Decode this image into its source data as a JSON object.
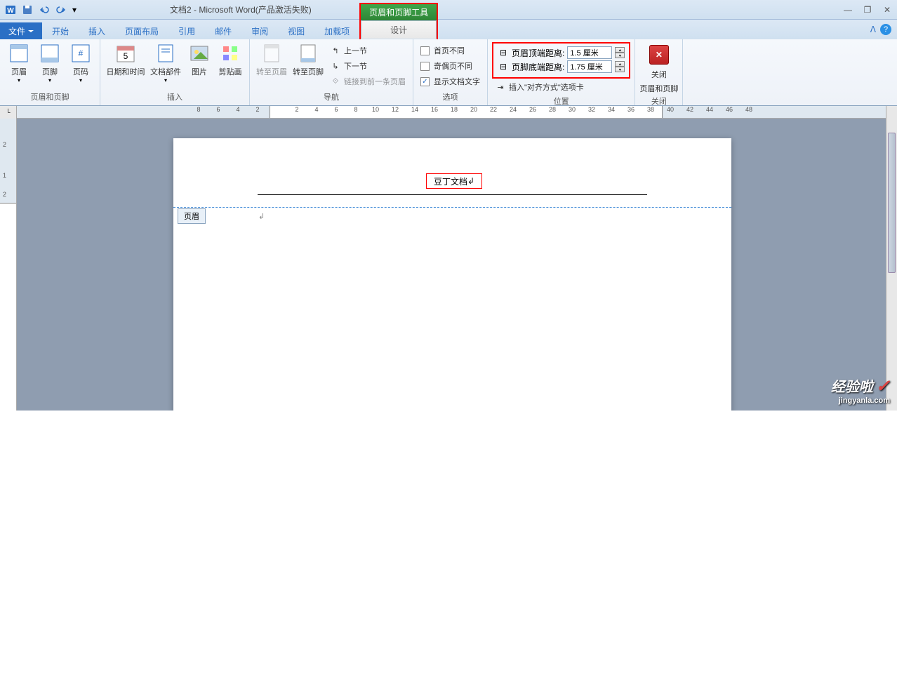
{
  "title": "文档2 - Microsoft Word(产品激活失败)",
  "contextual": {
    "group": "页眉和页脚工具",
    "tab": "设计"
  },
  "tabs": {
    "file": "文件",
    "items": [
      "开始",
      "插入",
      "页面布局",
      "引用",
      "邮件",
      "审阅",
      "视图",
      "加载项"
    ]
  },
  "ribbon": {
    "group1": {
      "label": "页眉和页脚",
      "header": "页眉",
      "footer": "页脚",
      "pagenum": "页码"
    },
    "group2": {
      "label": "插入",
      "datetime": "日期和时间",
      "docparts": "文档部件",
      "picture": "图片",
      "clipart": "剪贴画"
    },
    "group3": {
      "label": "导航",
      "goto_header": "转至页眉",
      "goto_footer": "转至页脚",
      "prev": "上一节",
      "next": "下一节",
      "link_prev": "链接到前一条页眉"
    },
    "group4": {
      "label": "选项",
      "first_diff": "首页不同",
      "odd_even": "奇偶页不同",
      "show_doc": "显示文档文字"
    },
    "group5": {
      "label": "位置",
      "header_top_label": "页眉顶端距离:",
      "header_top_val": "1.5 厘米",
      "footer_bottom_label": "页脚底端距离:",
      "footer_bottom_val": "1.75 厘米",
      "insert_align": "插入\"对齐方式\"选项卡"
    },
    "group6": {
      "label": "关闭",
      "close": "关闭",
      "close_sub": "页眉和页脚"
    }
  },
  "ruler_h": [
    "8",
    "6",
    "4",
    "2",
    "",
    "2",
    "4",
    "6",
    "8",
    "10",
    "12",
    "14",
    "16",
    "18",
    "20",
    "22",
    "24",
    "26",
    "28",
    "30",
    "32",
    "34",
    "36",
    "38",
    "40",
    "42",
    "44",
    "46",
    "48"
  ],
  "ruler_v": [
    "2",
    "",
    "1",
    "2"
  ],
  "doc": {
    "header_text": "豆丁文档",
    "header_tag": "页眉"
  },
  "watermark": {
    "main": "经验啦",
    "sub": "jingyanla.com"
  }
}
